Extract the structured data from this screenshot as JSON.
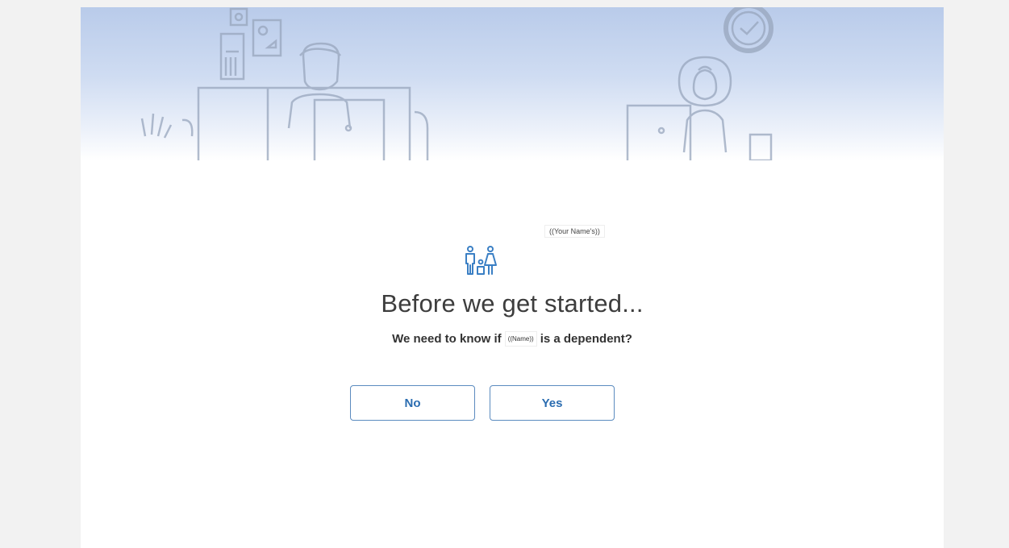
{
  "placeholder_tag": "((Your Name's))",
  "heading": "Before we get started...",
  "question": {
    "prefix": "We need to know if",
    "name_chip": "((Name))",
    "suffix": "is a dependent?"
  },
  "buttons": {
    "no": "No",
    "yes": "Yes"
  },
  "icons": {
    "family": "family-icon",
    "clock": "clock-icon"
  },
  "colors": {
    "accent": "#2a6cb0",
    "button_border": "#5b8bbf",
    "hero_top": "#b9cbea"
  }
}
